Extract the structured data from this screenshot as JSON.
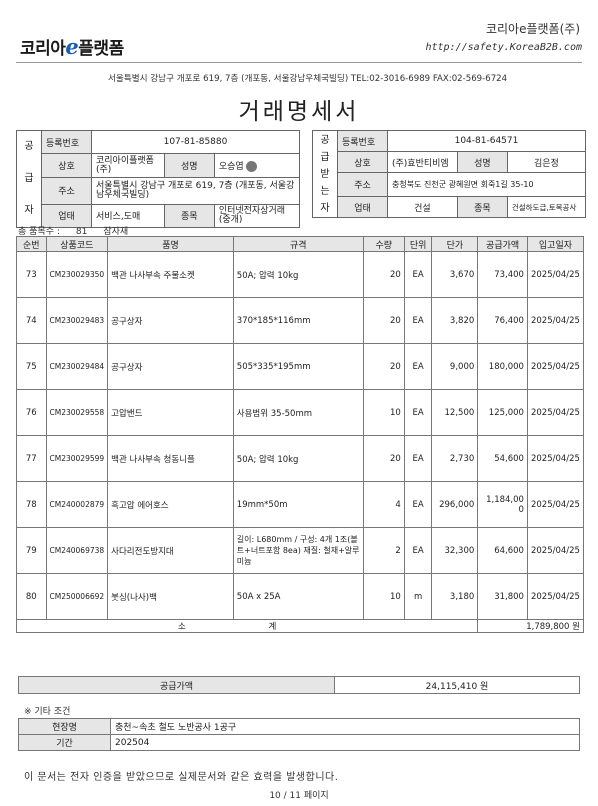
{
  "header": {
    "logo_prefix": "코리아",
    "logo_e": "e",
    "logo_suffix": "플랫폼",
    "company": "코리아e플랫폼(주)",
    "url": "http://safety.KoreaB2B.com",
    "address": "서울특별시 강남구 개포로 619, 7층 (개포동, 서울강남우체국빌딩) TEL:02-3016-6989 FAX:02-569-6724"
  },
  "title": "거래명세서",
  "supplier": {
    "side_label": [
      "공",
      "급",
      "자"
    ],
    "reg_label": "등록번호",
    "reg_no": "107-81-85880",
    "name_label": "상호",
    "name": "코리아이플랫폼(주)",
    "rep_label": "성명",
    "rep": "오승엽",
    "addr_label": "주소",
    "addr": "서울특별시 강남구 개포로 619, 7층 (개포동, 서울강남우체국빌딩)",
    "biz_label": "업태",
    "biz": "서비스,도매",
    "type_label": "종목",
    "type": "인터넷전자상거래(중개)"
  },
  "receiver": {
    "side_label": [
      "공",
      "급",
      "받",
      "는",
      "자"
    ],
    "reg_label": "등록번호",
    "reg_no": "104-81-64571",
    "name_label": "상호",
    "name": "(주)효반티비엠",
    "rep_label": "성명",
    "rep": "김은정",
    "addr_label": "주소",
    "addr": "충청북도 진천군 광혜원면 회죽1길 35-10",
    "biz_label": "업태",
    "biz": "건설",
    "type_label": "종목",
    "type": "건설하도급,토목공사"
  },
  "summary": {
    "count_label": "총 품목수 :",
    "count": "81",
    "note": "잠자재"
  },
  "columns": [
    "순번",
    "상품코드",
    "품명",
    "규격",
    "수량",
    "단위",
    "단가",
    "공급가액",
    "입고일자"
  ],
  "items": [
    {
      "no": "73",
      "code": "CM230029350",
      "name": "백관 나사부속 주물소켓",
      "spec": "50A; 압력 10kg",
      "qty": "20",
      "unit": "EA",
      "price": "3,670",
      "amount": "73,400",
      "date": "2025/04/25"
    },
    {
      "no": "74",
      "code": "CM230029483",
      "name": "공구상자",
      "spec": "370*185*116mm",
      "qty": "20",
      "unit": "EA",
      "price": "3,820",
      "amount": "76,400",
      "date": "2025/04/25"
    },
    {
      "no": "75",
      "code": "CM230029484",
      "name": "공구상자",
      "spec": "505*335*195mm",
      "qty": "20",
      "unit": "EA",
      "price": "9,000",
      "amount": "180,000",
      "date": "2025/04/25"
    },
    {
      "no": "76",
      "code": "CM230029558",
      "name": "고압밴드",
      "spec": "사용범위 35-50mm",
      "qty": "10",
      "unit": "EA",
      "price": "12,500",
      "amount": "125,000",
      "date": "2025/04/25"
    },
    {
      "no": "77",
      "code": "CM230029599",
      "name": "백관 나사부속 청동니플",
      "spec": "50A; 압력 10kg",
      "qty": "20",
      "unit": "EA",
      "price": "2,730",
      "amount": "54,600",
      "date": "2025/04/25"
    },
    {
      "no": "78",
      "code": "CM240002879",
      "name": "흑고압 에어호스",
      "spec": "19mm*50m",
      "qty": "4",
      "unit": "EA",
      "price": "296,000",
      "amount": "1,184,000",
      "date": "2025/04/25"
    },
    {
      "no": "79",
      "code": "CM240069738",
      "name": "사다리전도방지대",
      "spec": "길이: L680mm / 구성: 4개 1조(볼트+너트포함 8ea) 재질: 철재+알루미늄",
      "qty": "2",
      "unit": "EA",
      "price": "32,300",
      "amount": "64,600",
      "date": "2025/04/25"
    },
    {
      "no": "80",
      "code": "CM250006692",
      "name": "붓싱(나사)백",
      "spec": "50A x 25A",
      "qty": "10",
      "unit": "m",
      "price": "3,180",
      "amount": "31,800",
      "date": "2025/04/25"
    }
  ],
  "subtotal": {
    "label": "소 계",
    "amount": "1,789,800 원"
  },
  "total": {
    "label": "공급가액",
    "amount": "24,115,410 원"
  },
  "other": {
    "label": "※ 기타 조건",
    "site_label": "현장명",
    "site": "충천~속초 철도 노반공사 1공구",
    "period_label": "기간",
    "period": "202504"
  },
  "notice": "이 문서는 전자 인증을 받았으므로 실제문서와 같은 효력을 발생합니다.",
  "page": "10 / 11 페이지"
}
